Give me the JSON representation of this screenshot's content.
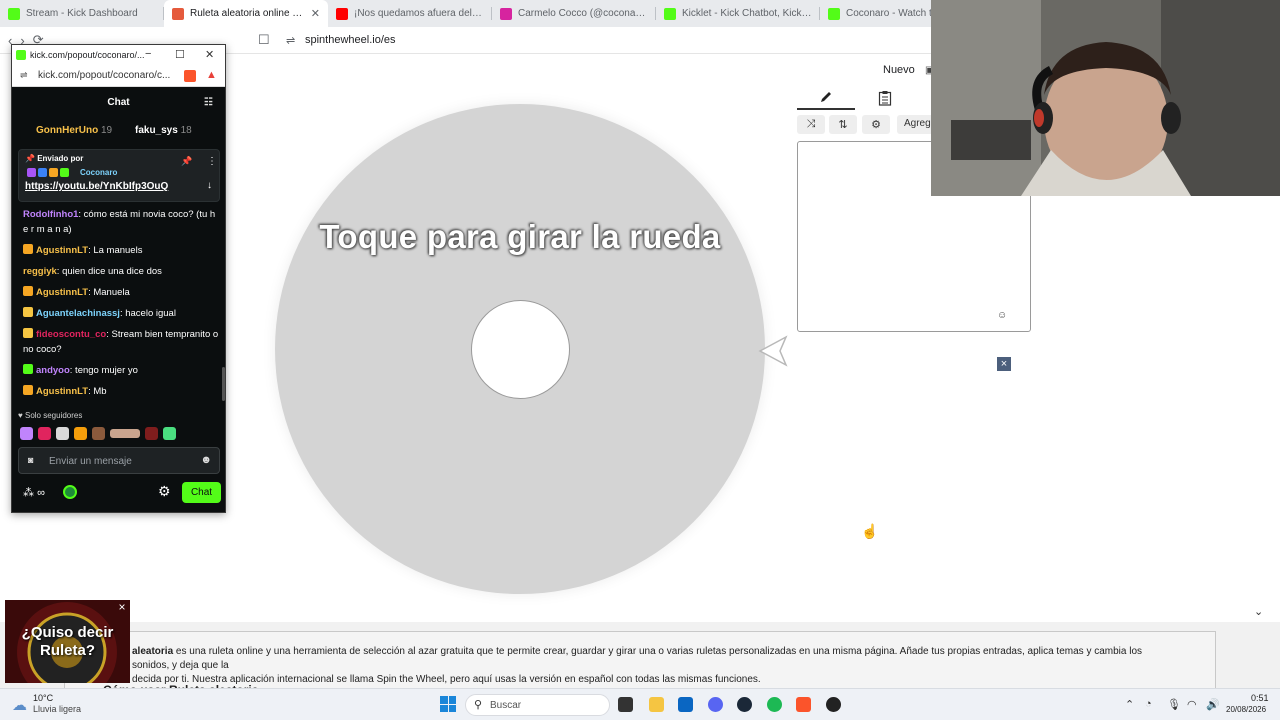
{
  "browser": {
    "tabs": [
      {
        "title": "Stream - Kick Dashboard",
        "color": "#53fc18",
        "active": false
      },
      {
        "title": "Ruleta aleatoria online – ruleta d",
        "color": "#e55a3c",
        "active": true
      },
      {
        "title": "¡Nos quedamos afuera del AURA? B",
        "color": "#ff0000",
        "active": false
      },
      {
        "title": "Carmelo Cocco (@coconaroo) • Insta",
        "color": "#d6249f",
        "active": false
      },
      {
        "title": "Kicklet - Kick Chatbot, Kick Widgets",
        "color": "#53fc18",
        "active": false
      },
      {
        "title": "Coconaro - Watch the V",
        "color": "#53fc18",
        "active": false
      }
    ],
    "url": "spinthewheel.io/es"
  },
  "wheel": {
    "prompt": "Toque para girar la rueda",
    "color": "#d4d4d4"
  },
  "editor": {
    "nuevo_label": "Nuevo",
    "add_label": "Agrega",
    "close_label": "×"
  },
  "description": {
    "brand": "aleatoria",
    "text": " es una ruleta online y una herramienta de selección al azar gratuita que te permite crear, guardar y girar una o varias ruletas personalizadas en una misma página. Añade tus propias entradas, aplica temas y cambia los sonidos, y deja que la",
    "text2": "decida por ti. Nuestra aplicación internacional se llama Spin the Wheel, pero aquí usas la versión en español con todas las mismas funciones.",
    "howto": "Cómo usar Ruleta aleatoria"
  },
  "ad": {
    "text": "¿Quiso decir Ruleta?",
    "close": "×"
  },
  "kick": {
    "window_title": "kick.com/popout/coconaro/...",
    "url": "kick.com/popout/coconaro/c...",
    "chat_title": "Chat",
    "leaders": [
      {
        "name": "GonnHerUno",
        "count": "19"
      },
      {
        "name": "faku_sys",
        "count": "18"
      }
    ],
    "pinned": {
      "label": "Enviado por",
      "user": "Coconaro",
      "link": "https://youtu.be/YnKbIfp3OuQ"
    },
    "messages": [
      {
        "user": "Rodolfinho1",
        "color": "#c084fc",
        "badge": "",
        "text": ": cómo está mi novia coco? (tu h e r m a n a)"
      },
      {
        "user": "AgustinnLT",
        "color": "#f7c04a",
        "badge": "#f5a623",
        "text": ": La manuels"
      },
      {
        "user": "reggiyk",
        "color": "#f7c04a",
        "badge": "",
        "text": ": quien dice una dice dos"
      },
      {
        "user": "AgustinnLT",
        "color": "#f7c04a",
        "badge": "#f5a623",
        "text": ": Manuela"
      },
      {
        "user": "Aguantelachinassj",
        "color": "#7dd3fc",
        "badge": "#f5c542",
        "text": ": hacelo igual"
      },
      {
        "user": "fideoscontu_co",
        "color": "#e0245e",
        "badge": "#f5c542",
        "text": ": Stream bien tempranito o no coco?"
      },
      {
        "user": "andyoo",
        "color": "#c084fc",
        "badge": "#53fc18",
        "text": ": tengo mujer yo"
      },
      {
        "user": "AgustinnLT",
        "color": "#f7c04a",
        "badge": "#f5a623",
        "text": ": Mb"
      }
    ],
    "followers_label": "Solo seguidores",
    "input_placeholder": "Enviar un mensaje",
    "send_label": "Chat",
    "infinity": "∞"
  },
  "taskbar": {
    "temp": "10°C",
    "weather": "Lluvia ligera",
    "search_placeholder": "Buscar",
    "time": "0:51",
    "date": "20/08/2026"
  }
}
